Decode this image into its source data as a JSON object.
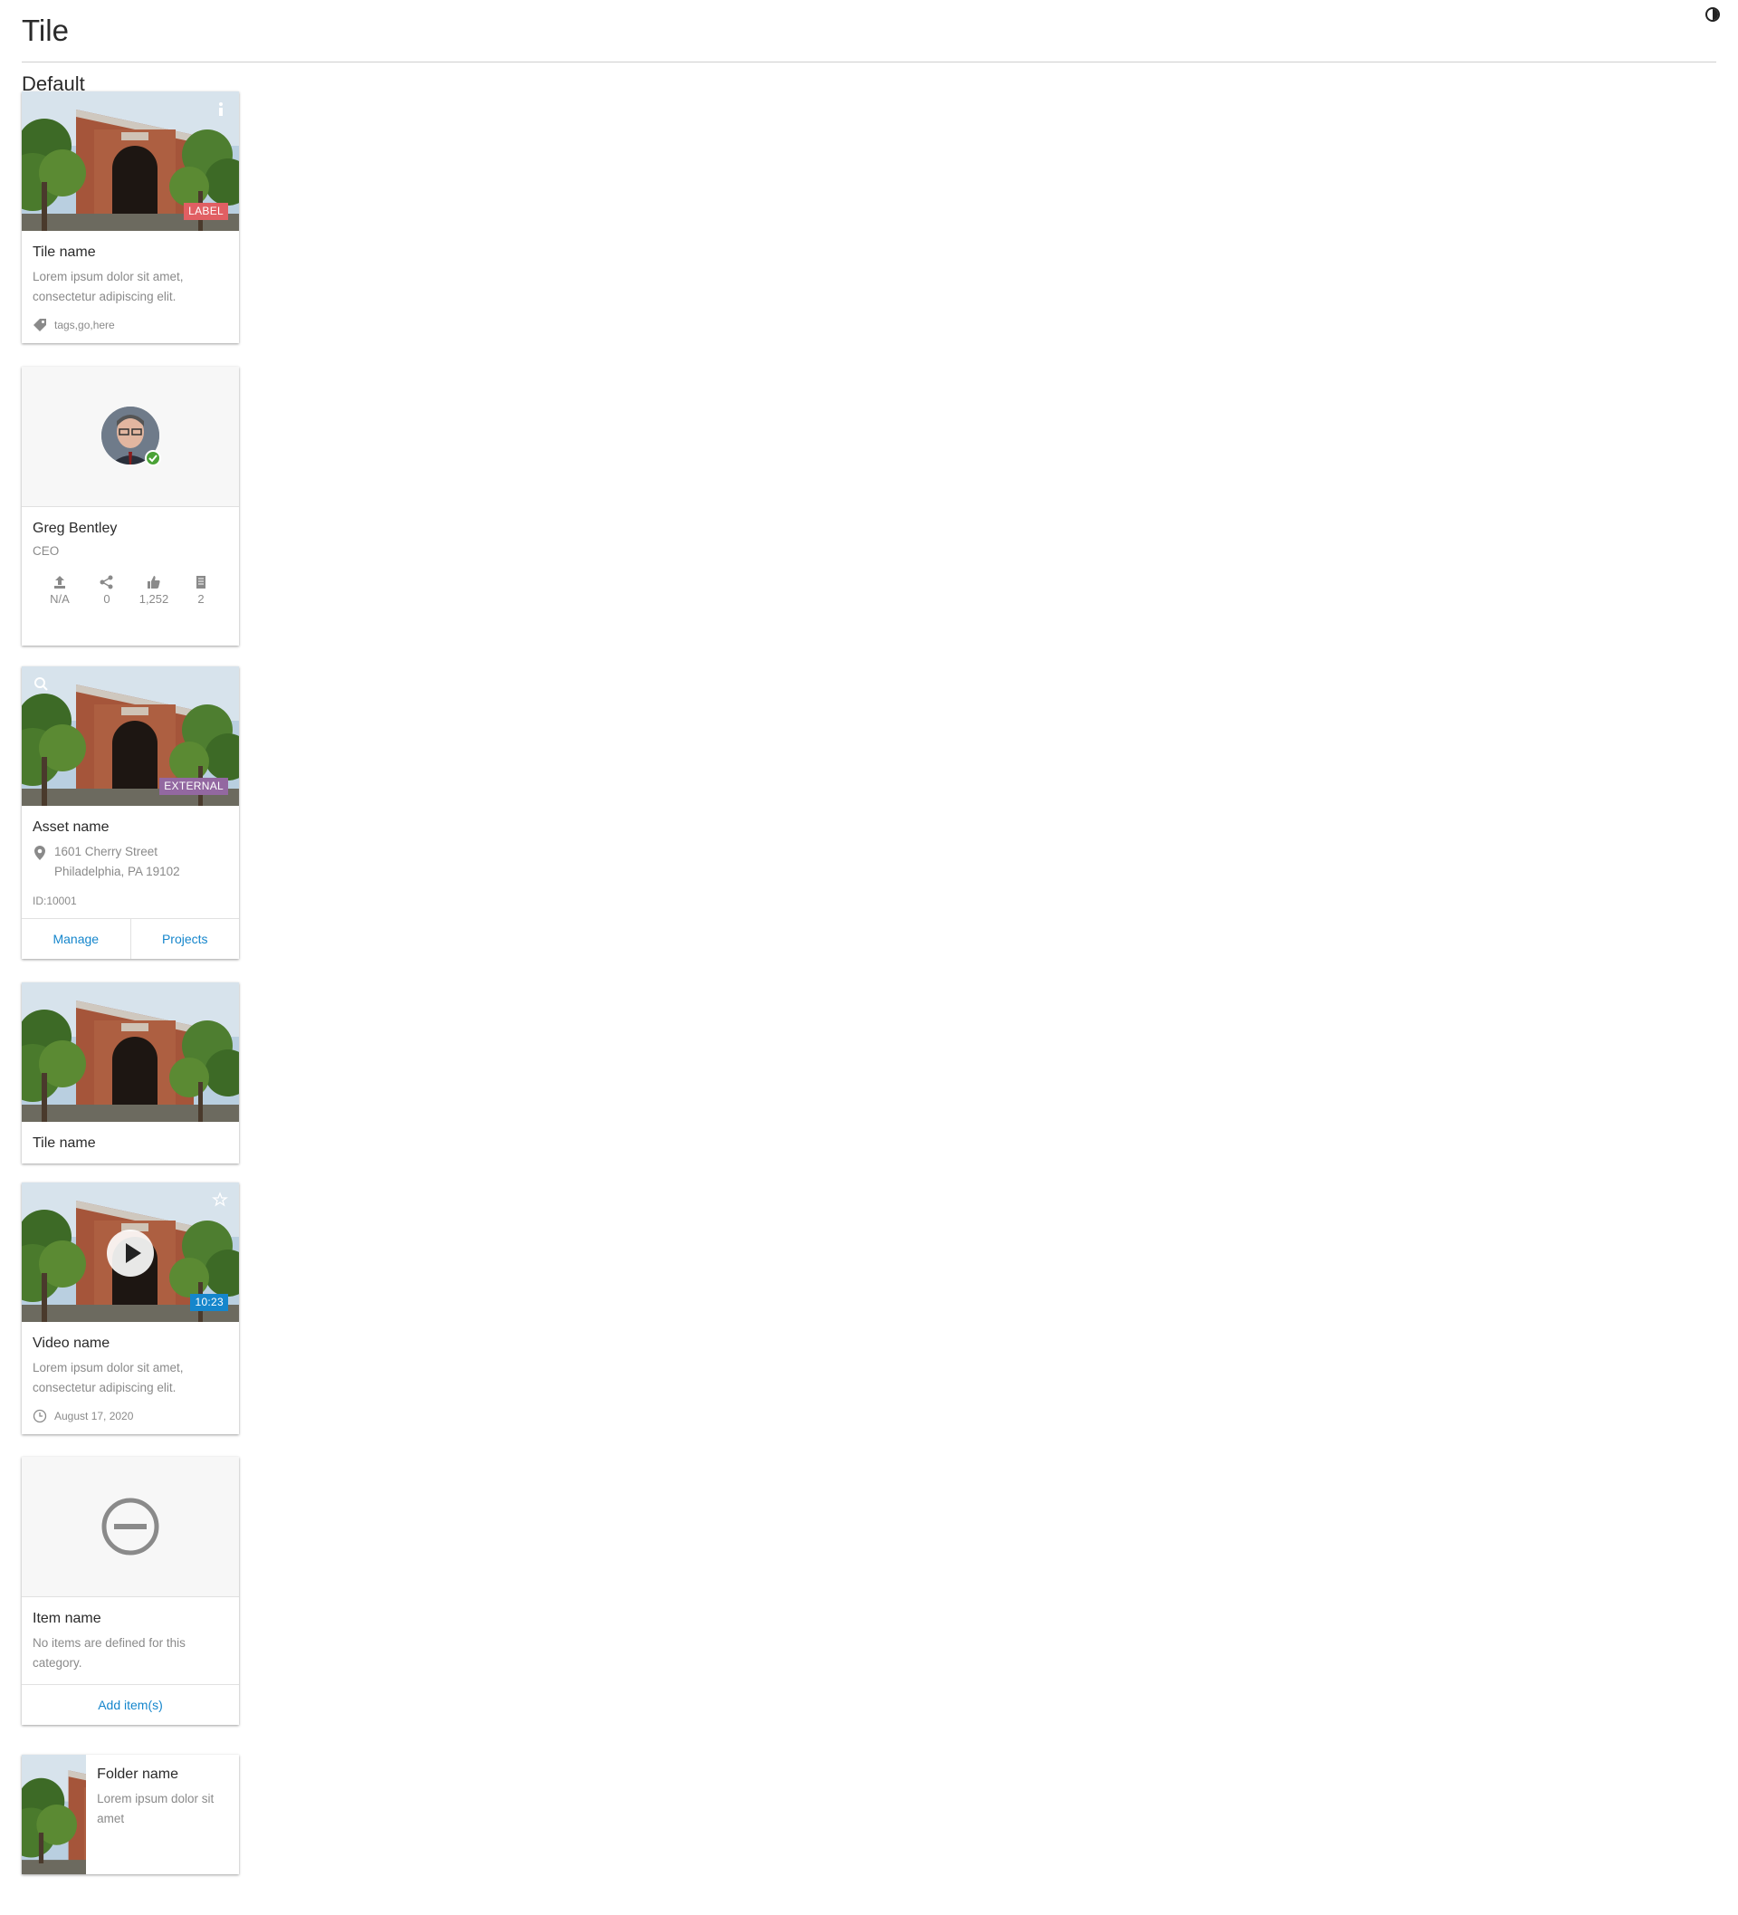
{
  "page": {
    "title": "Tile",
    "section": "Default"
  },
  "tiles": {
    "basic": {
      "name": "Tile name",
      "description": "Lorem ipsum dolor sit amet, consectetur adipiscing elit.",
      "badge": "LABEL",
      "tags": "tags,go,here",
      "badge_color": "#e15f63"
    },
    "user": {
      "name": "Greg Bentley",
      "role": "CEO",
      "stats": [
        {
          "icon": "upload-icon",
          "value": "N/A"
        },
        {
          "icon": "share-icon",
          "value": "0"
        },
        {
          "icon": "thumbs-up-icon",
          "value": "1,252"
        },
        {
          "icon": "document-icon",
          "value": "2"
        }
      ],
      "status_color": "#4aa236"
    },
    "asset": {
      "name": "Asset name",
      "address_line1": "1601 Cherry Street",
      "address_line2": "Philadelphia, PA 19102",
      "id_label": "ID:10001",
      "badge": "EXTERNAL",
      "badge_color": "#9368a1",
      "actions": [
        "Manage",
        "Projects"
      ]
    },
    "minimal": {
      "name": "Tile name"
    },
    "video": {
      "name": "Video name",
      "description": "Lorem ipsum dolor sit amet, consectetur adipiscing elit.",
      "duration": "10:23",
      "date": "August 17, 2020",
      "badge_color": "#1586cc"
    },
    "empty": {
      "name": "Item name",
      "description": "No items are defined for this category.",
      "action": "Add item(s)"
    },
    "folder": {
      "name": "Folder name",
      "description": "Lorem ipsum dolor sit amet"
    }
  },
  "colors": {
    "link": "#1586cc",
    "muted_text": "#8a8a8a"
  }
}
